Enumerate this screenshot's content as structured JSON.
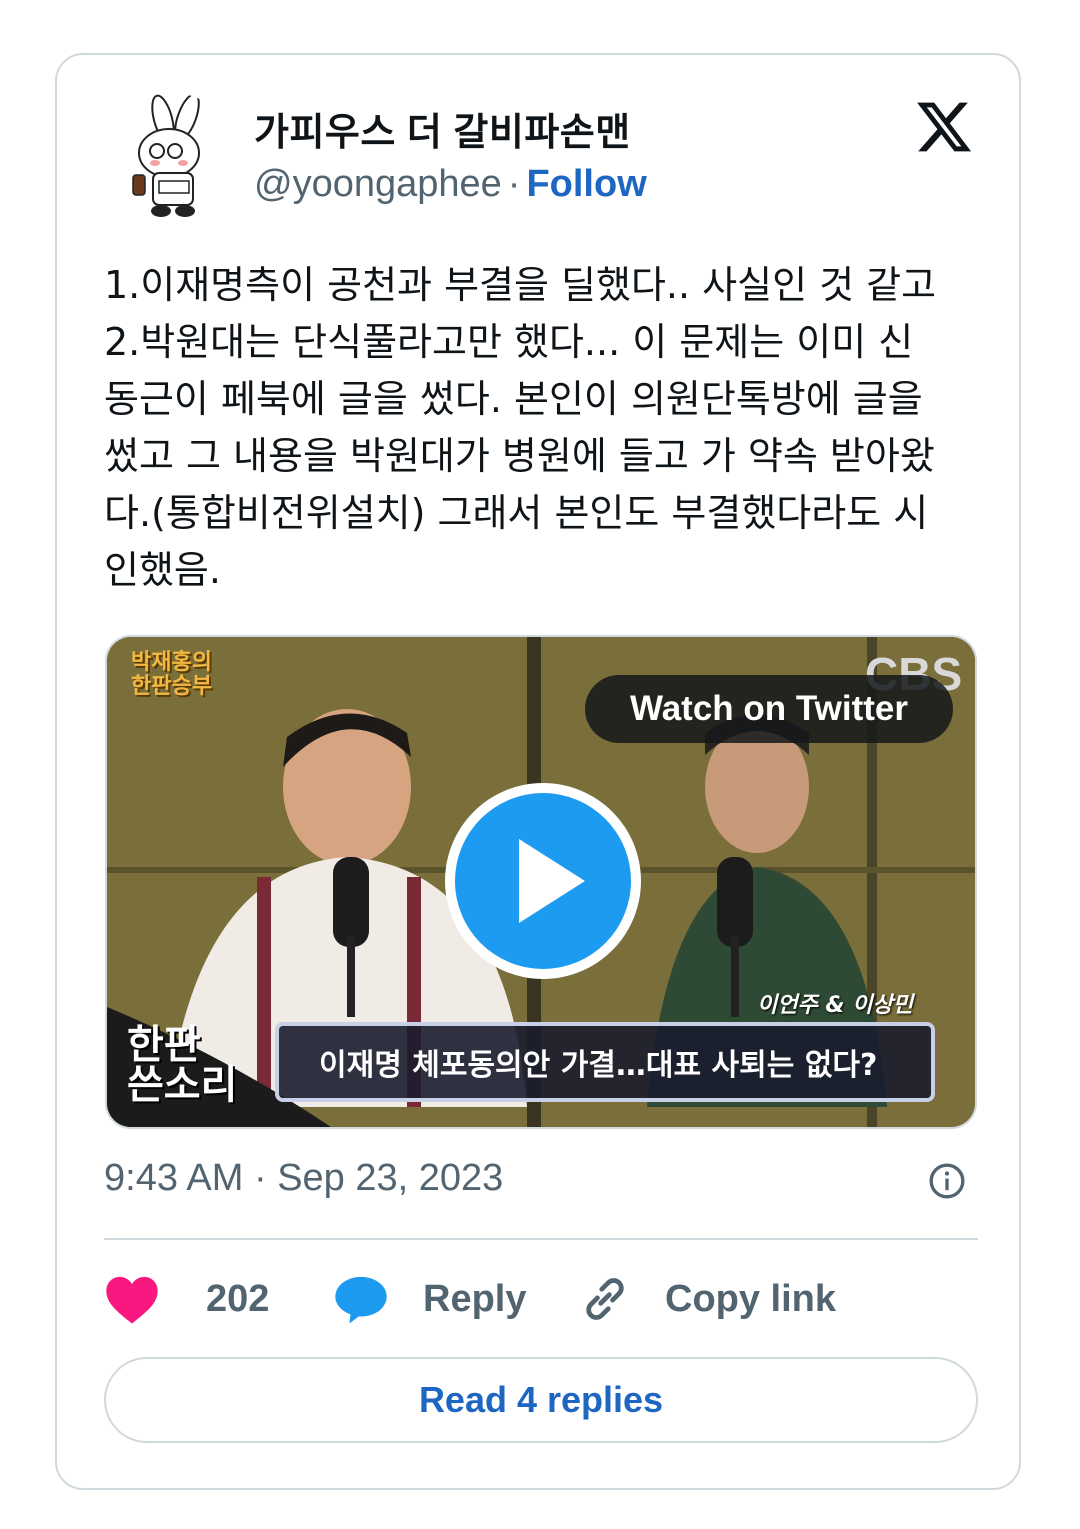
{
  "author": {
    "display_name": "가피우스 더 갈비파손맨",
    "handle": "@yoongaphee",
    "separator": "·",
    "follow_label": "Follow"
  },
  "tweet": {
    "text": "1.이재명측이 공천과 부결을 딜했다.. 사실인 것 같고\n2.박원대는 단식풀라고만 했다... 이 문제는 이미 신\n동근이 페북에 글을 썼다. 본인이 의원단톡방에 글을\n썼고 그 내용을 박원대가 병원에 들고 가 약속 받아왔\n다.(통합비전위설치) 그래서 본인도 부결했다라도 시\n인했음.",
    "timestamp": "9:43 AM · Sep 23, 2023"
  },
  "media": {
    "watch_label": "Watch on Twitter",
    "show_badge": "박재홍의\n한판승부",
    "broadcaster": "CBS",
    "caption_names": "이언주 & 이상민",
    "caption_headline": "이재명 체포동의안 가결…대표 사퇴는 없다?",
    "caption_segment": "한판\n쓴소리"
  },
  "actions": {
    "like_count": "202",
    "reply_label": "Reply",
    "copy_label": "Copy link",
    "read_replies_label": "Read 4 replies"
  },
  "colors": {
    "like": "#f91880",
    "reply": "#1d9bf0",
    "link": "#1d66c2",
    "muted": "#536471",
    "border": "#cfd9de"
  },
  "icons": {
    "platform": "x-logo-icon",
    "like": "heart-icon",
    "reply": "speech-bubble-icon",
    "copy": "link-icon",
    "info": "info-icon",
    "play": "play-icon"
  }
}
